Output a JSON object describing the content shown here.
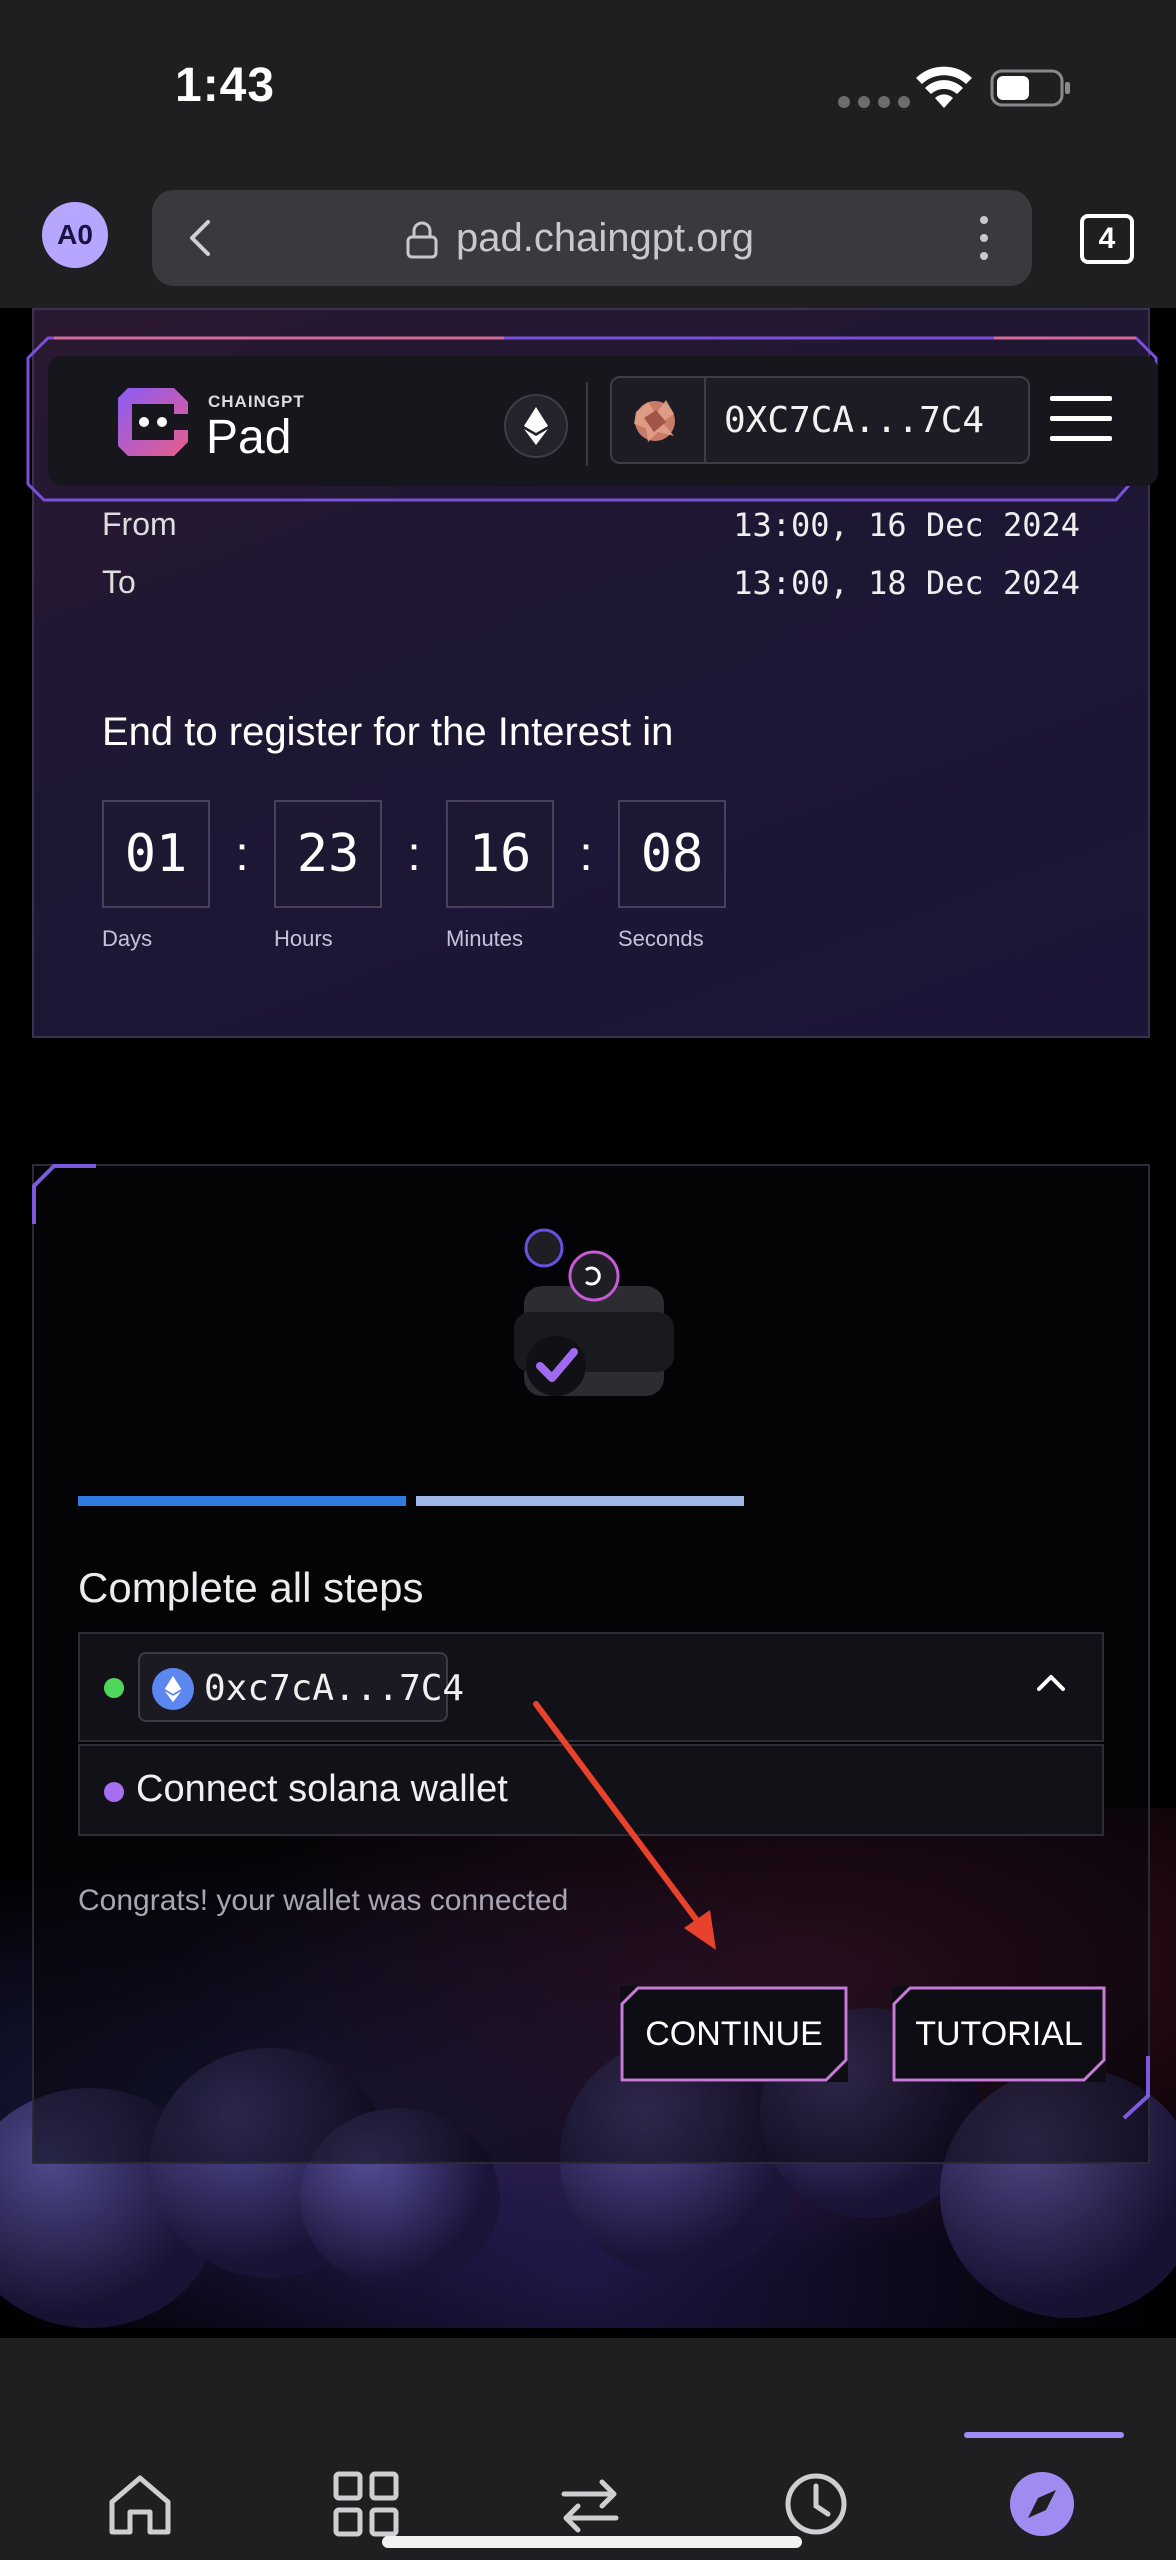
{
  "status_bar": {
    "time": "1:43"
  },
  "browser": {
    "avatar_initials": "A0",
    "url": "pad.chaingpt.org",
    "tab_count": "4"
  },
  "header": {
    "brand_small": "CHAINGPT",
    "brand_big": "Pad",
    "network_icon": "ethereum-icon",
    "wallet_address": "0XC7CA...7C4"
  },
  "info": {
    "from_label": "From",
    "from_value": "13:00, 16 Dec 2024",
    "to_label": "To",
    "to_value": "13:00, 18 Dec 2024",
    "register_title": "End to register for the Interest in",
    "countdown": [
      {
        "value": "01",
        "label": "Days"
      },
      {
        "value": "23",
        "label": "Hours"
      },
      {
        "value": "16",
        "label": "Minutes"
      },
      {
        "value": "08",
        "label": "Seconds"
      }
    ]
  },
  "steps": {
    "title": "Complete all steps",
    "progress": [
      1,
      1
    ],
    "progress_colors": [
      "#2f7be0",
      "#9fb8e8"
    ],
    "wallet_step_address": "0xc7cA...7C4",
    "solana_step_label": "Connect solana wallet",
    "congrats_text": "Congrats! your wallet was connected",
    "continue_label": "CONTINUE",
    "tutorial_label": "TUTORIAL"
  },
  "bottom_nav": {
    "items": [
      "home-icon",
      "grid-icon",
      "swap-icon",
      "history-icon",
      "compass-icon"
    ],
    "active": "compass-icon"
  },
  "colors": {
    "accent_purple": "#a66ff0",
    "status_green": "#4fd65a",
    "annotation_red": "#e8422c"
  }
}
